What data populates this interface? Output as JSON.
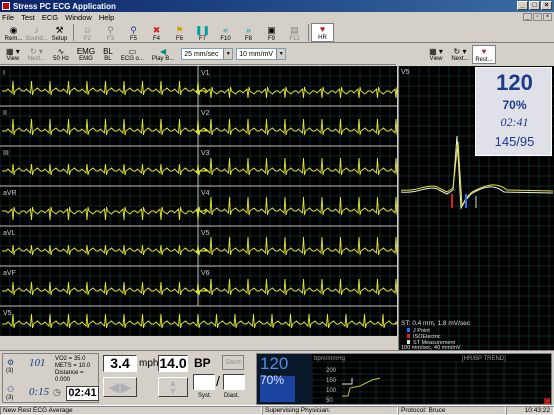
{
  "window": {
    "title": "Stress PC ECG Application",
    "min": "_",
    "max": "□",
    "close": "×"
  },
  "menu": [
    "File",
    "Test",
    "ECG",
    "Window",
    "Help"
  ],
  "toolbar": [
    {
      "label": "Rem...",
      "icon": "remote-icon",
      "glyph": "◉",
      "enabled": true
    },
    {
      "label": "Sound...",
      "icon": "speaker-icon",
      "glyph": "♪",
      "enabled": false
    },
    {
      "label": "Setup",
      "icon": "wrench-icon",
      "glyph": "⚒",
      "enabled": true
    },
    {
      "label": "F2",
      "icon": "patient-icon",
      "glyph": "☺",
      "enabled": false
    },
    {
      "label": "F3",
      "icon": "runner-icon",
      "glyph": "⚲",
      "enabled": false
    },
    {
      "label": "F5",
      "icon": "walk-icon",
      "glyph": "⚲",
      "enabled": true,
      "color": "#1a3a9a"
    },
    {
      "label": "F4",
      "icon": "stop-icon",
      "glyph": "✖",
      "enabled": true,
      "color": "#d02020"
    },
    {
      "label": "F6",
      "icon": "flag-icon",
      "glyph": "⚑",
      "enabled": true,
      "color": "#c8a000"
    },
    {
      "label": "F7",
      "icon": "pause-icon",
      "glyph": "❚❚",
      "enabled": true,
      "color": "#00a0a0"
    },
    {
      "label": "F10",
      "icon": "rewind-icon",
      "glyph": "«",
      "enabled": true,
      "color": "#00a0a0"
    },
    {
      "label": "F8",
      "icon": "fast-forward-icon",
      "glyph": "»",
      "enabled": true,
      "color": "#00a0a0"
    },
    {
      "label": "F9",
      "icon": "recorder-icon",
      "glyph": "▣",
      "enabled": true
    },
    {
      "label": "F12",
      "icon": "printer-icon",
      "glyph": "▤",
      "enabled": false
    },
    {
      "label": "HR",
      "icon": "heart-rate-icon",
      "glyph": "♥",
      "enabled": true,
      "active": true,
      "color": "#c02030"
    }
  ],
  "ecg_toolbar": {
    "items": [
      {
        "label": "View",
        "icon": "view-icon",
        "glyph": "▦",
        "enabled": true,
        "dropdown": true
      },
      {
        "label": "Next...",
        "icon": "refresh-icon",
        "glyph": "↻",
        "enabled": false,
        "dropdown": true
      },
      {
        "label": "50 Hz",
        "icon": "filter-icon",
        "glyph": "∿",
        "enabled": true
      },
      {
        "label": "EMG",
        "icon": "emg-icon",
        "glyph": "EMG",
        "enabled": true
      },
      {
        "label": "BL",
        "icon": "baseline-icon",
        "glyph": "BL",
        "enabled": true
      },
      {
        "label": "ECG o...",
        "icon": "ecg-output-icon",
        "glyph": "▭",
        "enabled": true
      },
      {
        "label": "Play B...",
        "icon": "play-back-icon",
        "glyph": "◀",
        "enabled": true,
        "color": "#009090"
      }
    ],
    "speed": "25 mm/sec",
    "gain": "10 mm/mV"
  },
  "right_toolbar": [
    {
      "label": "View",
      "icon": "view-icon",
      "glyph": "▦",
      "dropdown": true
    },
    {
      "label": "Next...",
      "icon": "refresh-icon",
      "glyph": "↻",
      "dropdown": true
    },
    {
      "label": "Rest...",
      "icon": "rest-icon",
      "glyph": "♥",
      "active": true
    }
  ],
  "leads_left": [
    "I",
    "II",
    "III",
    "aVR",
    "aVL",
    "aVF"
  ],
  "leads_right": [
    "V1",
    "V2",
    "V3",
    "V4",
    "V5",
    "V6"
  ],
  "rhythm_lead": "V5",
  "avg_lead": "V5",
  "vitals": {
    "hr": "120",
    "pct": "70%",
    "time": "02:41",
    "bp": "145/95"
  },
  "st_info": {
    "line": "ST: 0.4 mm, 1.8 mV/sec",
    "legend": [
      {
        "key": "J",
        "label": "J Point",
        "color": "#3070ff"
      },
      {
        "key": "I",
        "label": "ISOElectric",
        "color": "#e02020"
      },
      {
        "key": "M",
        "label": "ST Measurement",
        "color": "#e0e0e0"
      }
    ],
    "scale": "100 mm/sec, 40 mm/mV"
  },
  "bottom": {
    "stage_num": "101",
    "vo2": "VO2 = 35.0",
    "mets": "METS = 10.0",
    "distance": "Distance = 0.000",
    "stage_time": "0:15",
    "clock": "02:41",
    "speed": "3.4",
    "speed_unit": "mph",
    "grade": "14.0",
    "bp_label": "BP",
    "save_label": "Save",
    "syst_label": "Syst.",
    "diast_label": "Diast.",
    "slash": "/",
    "stage_prefix": "(3)",
    "stage_prefix2": "(3)"
  },
  "trend": {
    "hr": "120",
    "pct": "70%",
    "unit": "bpm/mmHg",
    "title": "[HR/BP TREND]",
    "ticks": [
      "200",
      "150",
      "100",
      "50"
    ]
  },
  "status": {
    "left": "New Rest ECG Average",
    "physician": "Supervising Physician:",
    "protocol": "Protocol: Bruce",
    "time": "10:43:22"
  }
}
